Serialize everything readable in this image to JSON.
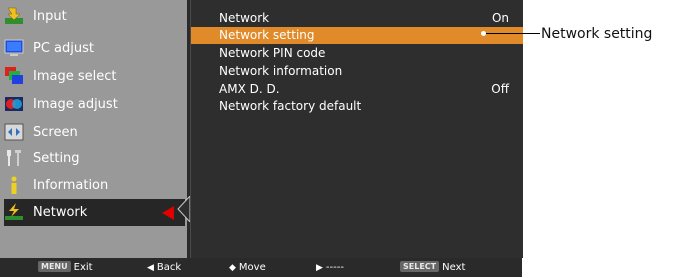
{
  "main_menu": {
    "items": [
      {
        "label": "Input",
        "icon": "input-icon"
      },
      {
        "label": "PC adjust",
        "icon": "pc-adjust-icon"
      },
      {
        "label": "Image select",
        "icon": "image-select-icon"
      },
      {
        "label": "Image adjust",
        "icon": "image-adjust-icon"
      },
      {
        "label": "Screen",
        "icon": "screen-icon"
      },
      {
        "label": "Setting",
        "icon": "setting-icon"
      },
      {
        "label": "Information",
        "icon": "information-icon"
      },
      {
        "label": "Network",
        "icon": "network-icon",
        "selected": true
      }
    ]
  },
  "network_menu": {
    "items": [
      {
        "label": "Network",
        "value": "On"
      },
      {
        "label": "Network setting",
        "value": "",
        "highlighted": true
      },
      {
        "label": "Network PIN code",
        "value": ""
      },
      {
        "label": "Network information",
        "value": ""
      },
      {
        "label": "AMX D. D.",
        "value": "Off"
      },
      {
        "label": "Network factory default",
        "value": ""
      }
    ]
  },
  "footer": {
    "exit_key": "MENU",
    "exit_label": "Exit",
    "back_label": "Back",
    "move_label": "Move",
    "next_placeholder": "-----",
    "select_key": "SELECT",
    "next_label": "Next"
  },
  "callout": {
    "label": "Network setting"
  },
  "colors": {
    "highlight": "#e08a2a",
    "selected_arrow": "#e00000",
    "left_panel_bg": "#999999",
    "right_panel_bg": "#2e2e2e"
  }
}
